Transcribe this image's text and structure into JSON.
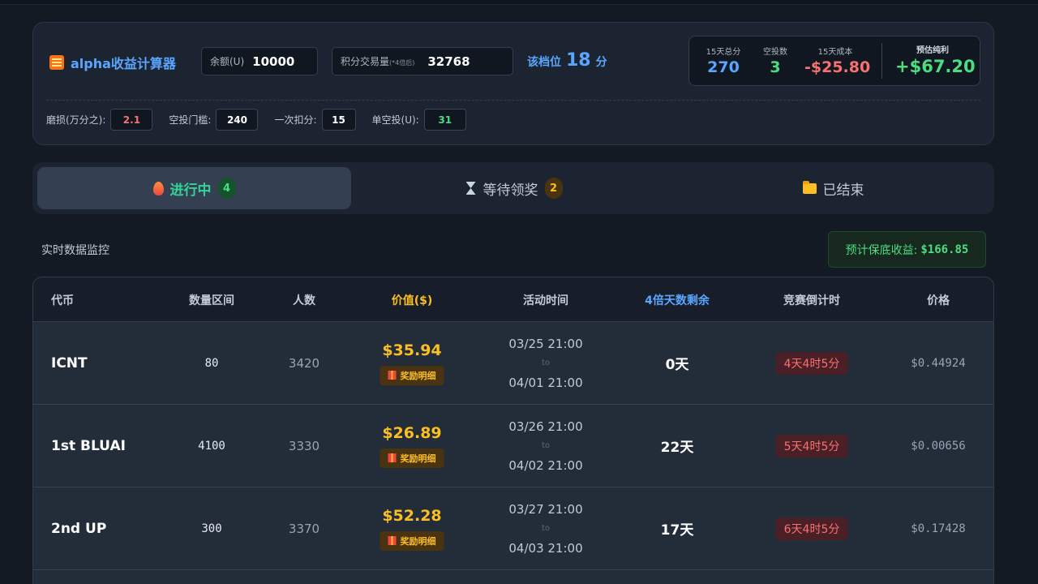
{
  "calculator": {
    "title": "alpha收益计算器",
    "balance_label": "余额(U)",
    "balance_value": "10000",
    "volume_label": "积分交易量",
    "volume_note": "(*4倍后)",
    "volume_value": "32768",
    "tier_label": "该档位",
    "tier_value": "18",
    "tier_unit": "分",
    "stats": {
      "total_points_label": "15天总分",
      "total_points_value": "270",
      "airdrops_label": "空投数",
      "airdrops_value": "3",
      "cost_label": "15天成本",
      "cost_value": "-$25.80",
      "profit_label": "预估纯利",
      "profit_value": "+$67.20"
    },
    "params": [
      {
        "label": "磨损(万分之):",
        "value": "2.1",
        "color": "#f87171"
      },
      {
        "label": "空投门槛:",
        "value": "240",
        "color": "#ffffff"
      },
      {
        "label": "一次扣分:",
        "value": "15",
        "color": "#ffffff"
      },
      {
        "label": "单空投(U):",
        "value": "31",
        "color": "#4ade80"
      }
    ]
  },
  "tabs": [
    {
      "label": "进行中",
      "count": "4",
      "icon": "fire-icon",
      "active": true
    },
    {
      "label": "等待领奖",
      "count": "2",
      "icon": "hourglass-icon",
      "active": false
    },
    {
      "label": "已结束",
      "count": "",
      "icon": "folder-icon",
      "active": false
    }
  ],
  "monitor": {
    "title": "实时数据监控",
    "guarantee_label": "预计保底收益:",
    "guarantee_value": "$166.85"
  },
  "table": {
    "headers": {
      "token": "代币",
      "quantity": "数量区间",
      "people": "人数",
      "value": "价值($)",
      "time": "活动时间",
      "days": "4倍天数剩余",
      "countdown": "竞赛倒计时",
      "price": "价格"
    },
    "reward_label": "奖励明细",
    "to_label": "to",
    "rows": [
      {
        "token": "ICNT",
        "quantity": "80",
        "people": "3420",
        "value": "$35.94",
        "start": "03/25 21:00",
        "end": "04/01 21:00",
        "days": "0天",
        "countdown": "4天4时5分",
        "price": "$0.44924"
      },
      {
        "token": "1st BLUAI",
        "quantity": "4100",
        "people": "3330",
        "value": "$26.89",
        "start": "03/26 21:00",
        "end": "04/02 21:00",
        "days": "22天",
        "countdown": "5天4时5分",
        "price": "$0.00656"
      },
      {
        "token": "2nd UP",
        "quantity": "300",
        "people": "3370",
        "value": "$52.28",
        "start": "03/27 21:00",
        "end": "04/03 21:00",
        "days": "17天",
        "countdown": "6天4时5分",
        "price": "$0.17428"
      }
    ]
  }
}
